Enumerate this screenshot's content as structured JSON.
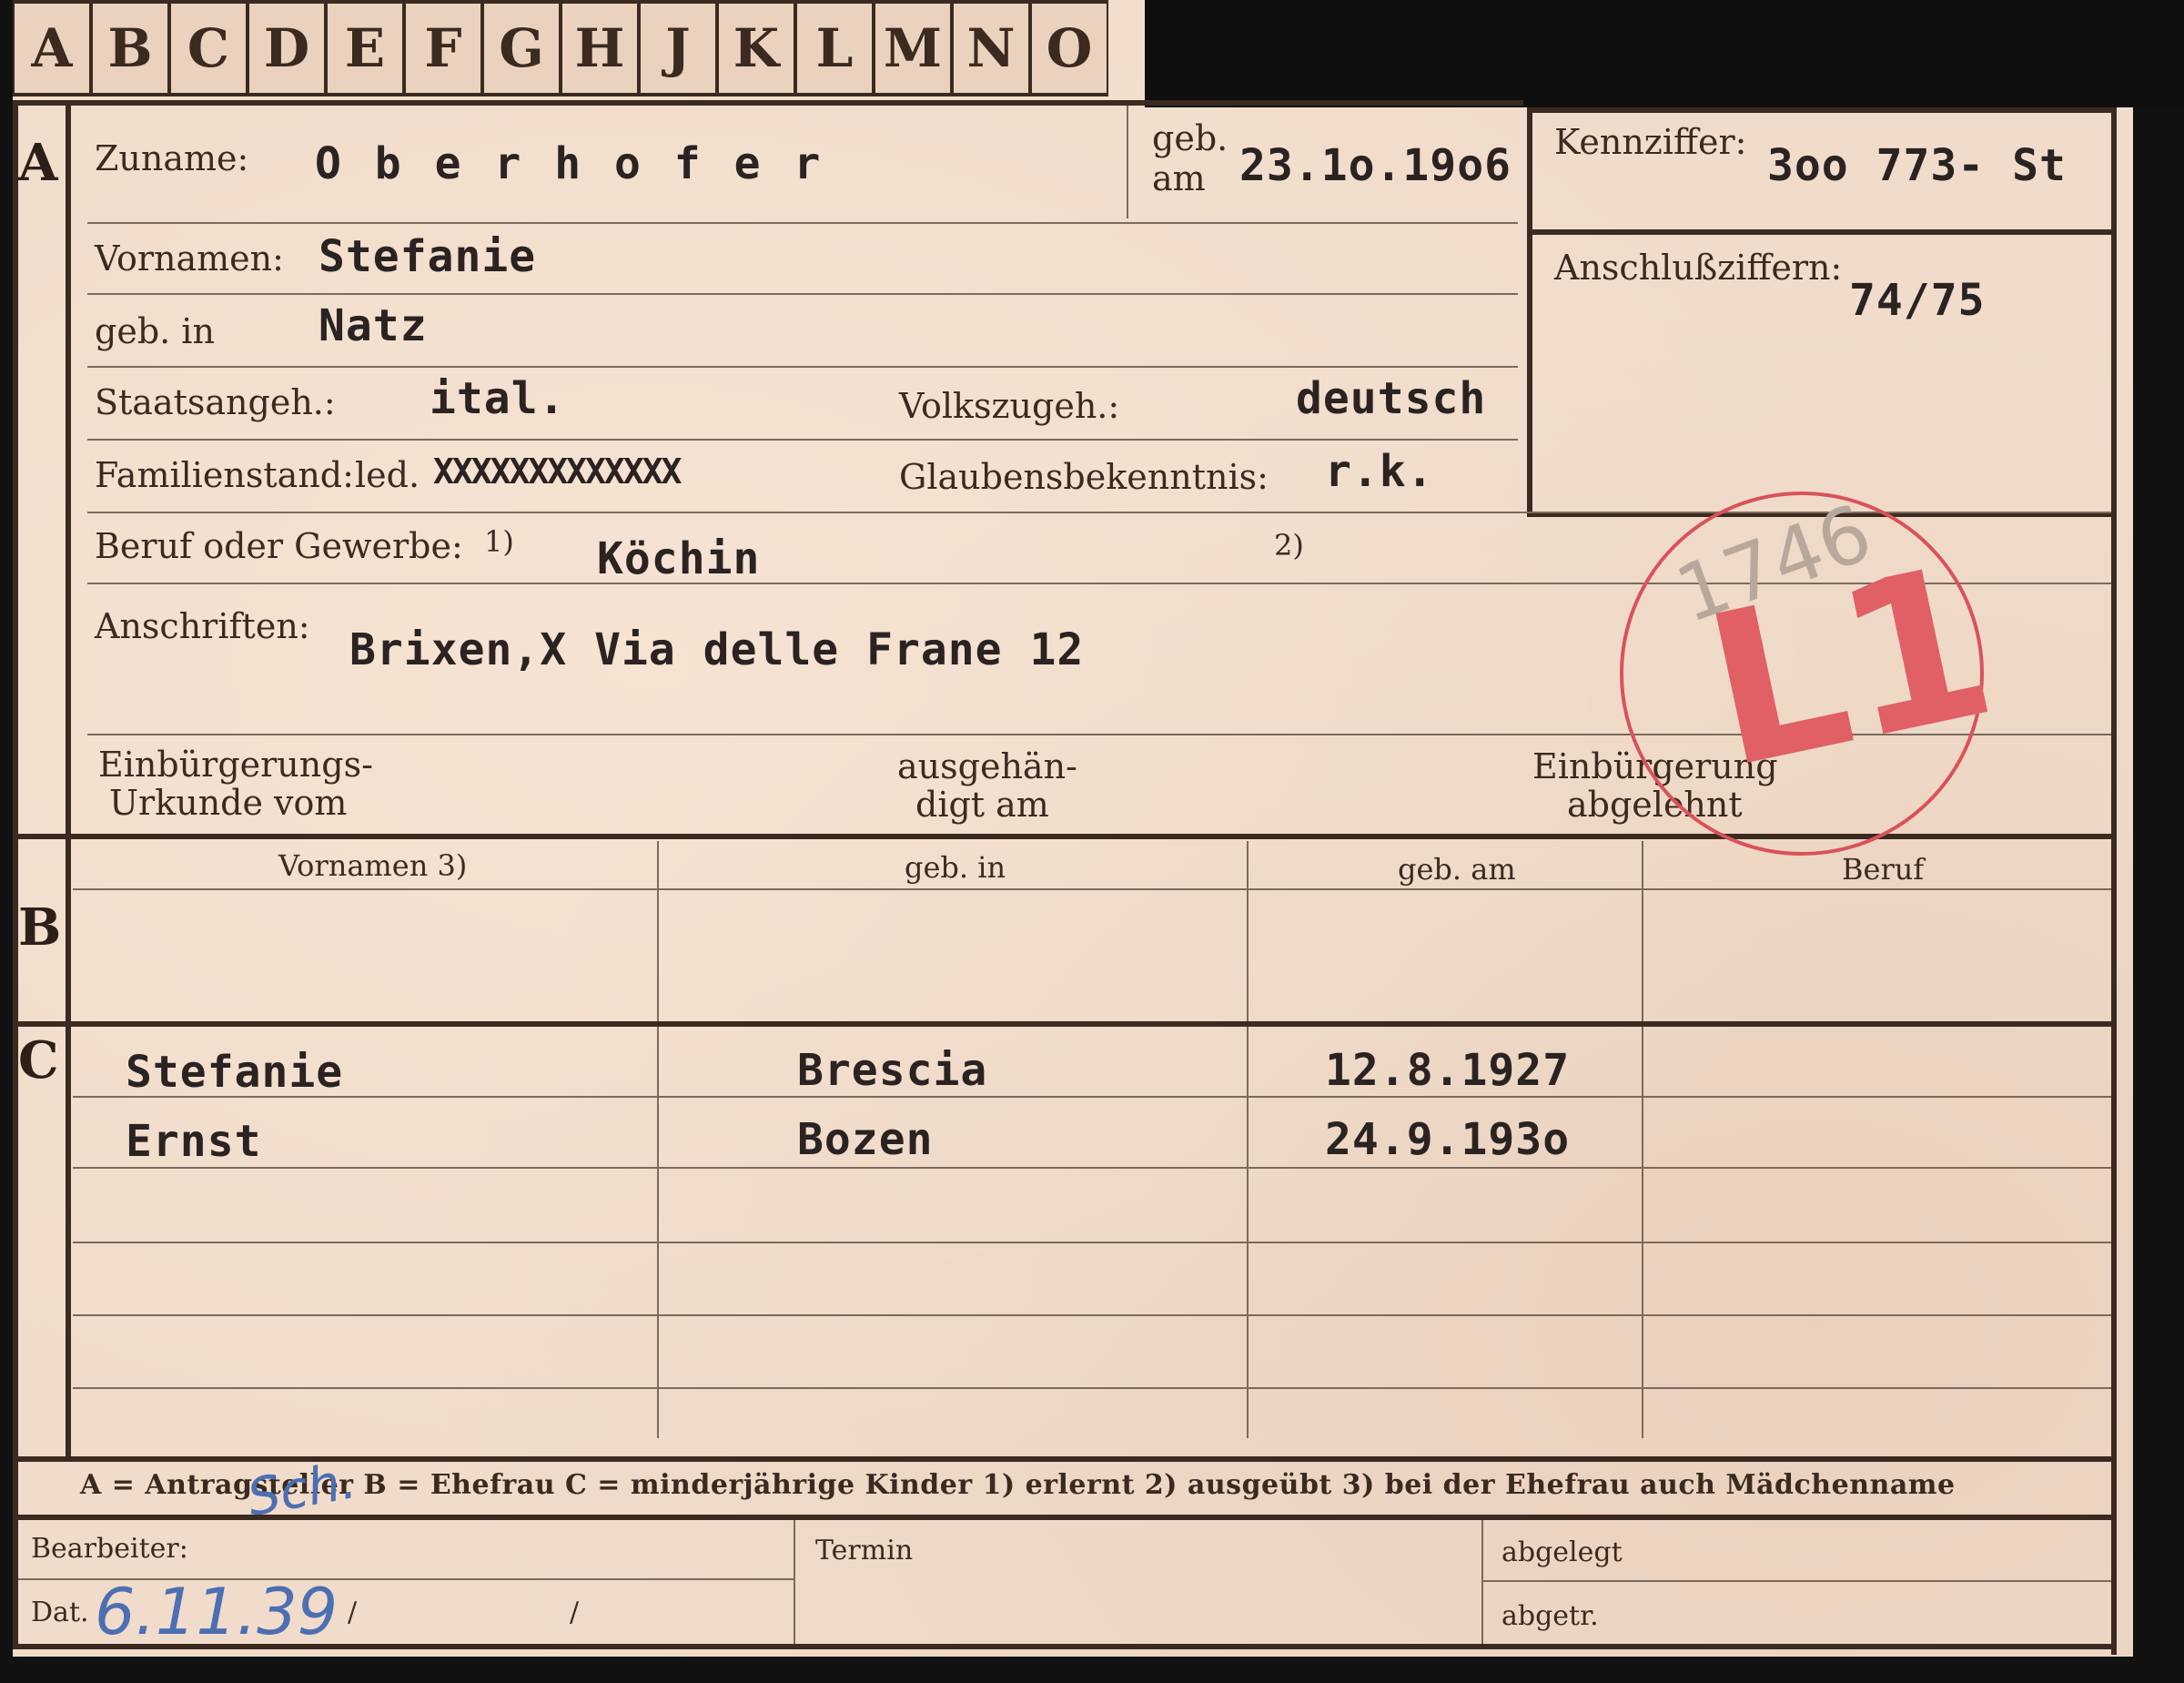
{
  "tabs": [
    "A",
    "B",
    "C",
    "D",
    "E",
    "F",
    "G",
    "H",
    "J",
    "K",
    "L",
    "M",
    "N",
    "O"
  ],
  "section_a": {
    "letter": "A",
    "zuname_label": "Zuname:",
    "zuname": "O b e r h o f e r",
    "geb_am_label_1": "geb.",
    "geb_am_label_2": "am",
    "geb_am": "23.1o.19o6",
    "kennziffer_label": "Kennziffer:",
    "kennziffer": "3oo 773-   St",
    "anschluss_label": "Anschlußziffern:",
    "anschluss": "74/75",
    "vornamen_label": "Vornamen:",
    "vornamen": "Stefanie",
    "geb_in_label": "geb. in",
    "geb_in": "Natz",
    "staatsangeh_label": "Staatsangeh.:",
    "staatsangeh": "ital.",
    "volkszugeh_label": "Volkszugeh.:",
    "volkszugeh": "deutsch",
    "familienstand_label": "Familienstand:",
    "familienstand_led": "led.",
    "familienstand_struck": "XXXXXXXXXXXXX",
    "glauben_label": "Glaubensbekenntnis:",
    "glauben": "r.k.",
    "beruf_label": "Beruf oder Gewerbe:",
    "beruf_mark1": "1)",
    "beruf": "Köchin",
    "beruf_mark2": "2)",
    "anschriften_label": "Anschriften:",
    "anschrift": "Brixen,X Via delle Frane 12",
    "einb_urkunde_1": "Einbürgerungs-",
    "einb_urkunde_2": "Urkunde vom",
    "ausgehaendigt_1": "ausgehän-",
    "ausgehaendigt_2": "digt am",
    "einb_abgelehnt_1": "Einbürgerung",
    "einb_abgelehnt_2": "abgelehnt"
  },
  "stamp": {
    "number": "1746",
    "mark": "L1"
  },
  "section_b": {
    "letter": "B",
    "headers": [
      "Vornamen 3)",
      "geb. in",
      "geb. am",
      "Beruf"
    ]
  },
  "section_c": {
    "letter": "C",
    "rows": [
      {
        "vorname": "Stefanie",
        "geb_in": "Brescia",
        "geb_am": "12.8.1927"
      },
      {
        "vorname": "Ernst",
        "geb_in": "Bozen",
        "geb_am": "24.9.193o"
      }
    ]
  },
  "legend": "A = Antragsteller   B = Ehefrau   C = minderjährige Kinder   1) erlernt   2) ausgeübt   3) bei der Ehefrau auch Mädchenname",
  "footer": {
    "bearbeiter_label": "Bearbeiter:",
    "dat_label": "Dat.",
    "dat_value": "6.11.39",
    "slash1": "/",
    "slash2": "/",
    "termin_label": "Termin",
    "abgelegt_label": "abgelegt",
    "abgetr_label": "abgetr.",
    "initials": "Sch."
  }
}
